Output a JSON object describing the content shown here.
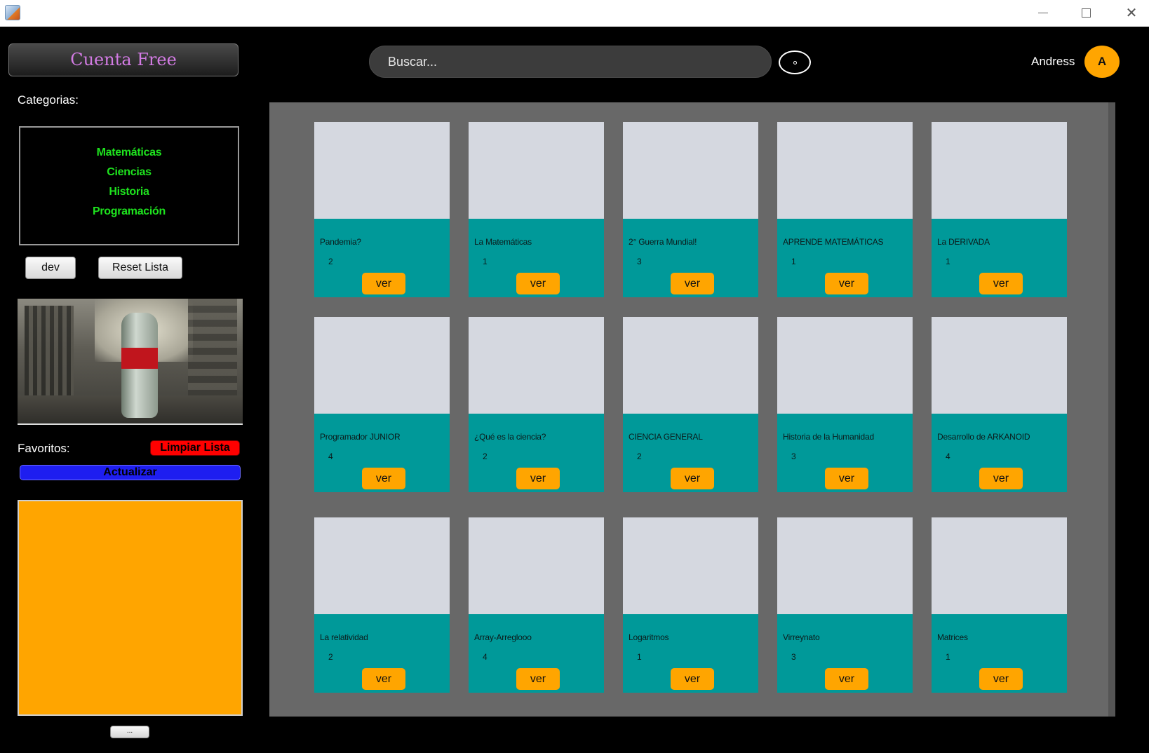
{
  "window": {
    "minimize_glyph": "—",
    "maximize_glyph": "☐",
    "close_glyph": "✕"
  },
  "sidebar": {
    "account_label": "Cuenta Free",
    "categories_label": "Categorias:",
    "categories": [
      "Matemáticas",
      "Ciencias",
      "Historia",
      "Programación"
    ],
    "dev_label": "dev",
    "reset_label": "Reset Lista",
    "favorites_label": "Favoritos:",
    "clear_label": "Limpiar Lista",
    "update_label": "Actualizar",
    "more_label": "..."
  },
  "header": {
    "search_placeholder": "Buscar...",
    "user_name": "Andress",
    "avatar_initial": "A"
  },
  "grid": {
    "button_label": "ver",
    "cards": [
      {
        "title": "Pandemia?",
        "count": "2"
      },
      {
        "title": "La Matemáticas",
        "count": "1"
      },
      {
        "title": "2° Guerra Mundial!",
        "count": "3"
      },
      {
        "title": "APRENDE MATEMÁTICAS",
        "count": "1"
      },
      {
        "title": "La DERIVADA",
        "count": "1"
      },
      {
        "title": "Programador JUNIOR",
        "count": "4"
      },
      {
        "title": "¿Qué es la ciencia?",
        "count": "2"
      },
      {
        "title": "CIENCIA GENERAL",
        "count": "2"
      },
      {
        "title": "Historia de la Humanidad",
        "count": "3"
      },
      {
        "title": "Desarrollo de ARKANOID",
        "count": "4"
      },
      {
        "title": "La relatividad",
        "count": "2"
      },
      {
        "title": "Array-Arreglooo",
        "count": "4"
      },
      {
        "title": "Logaritmos",
        "count": "1"
      },
      {
        "title": "Virreynato",
        "count": "3"
      },
      {
        "title": "Matrices",
        "count": "1"
      }
    ]
  },
  "colors": {
    "card_bg": "#009999",
    "thumb_bg": "#d5d8e0",
    "accent_orange": "#ffa500",
    "category_green": "#1ee31e",
    "account_text": "#d27be3",
    "clear_red": "#ff0000",
    "update_blue": "#1e1ef0"
  }
}
